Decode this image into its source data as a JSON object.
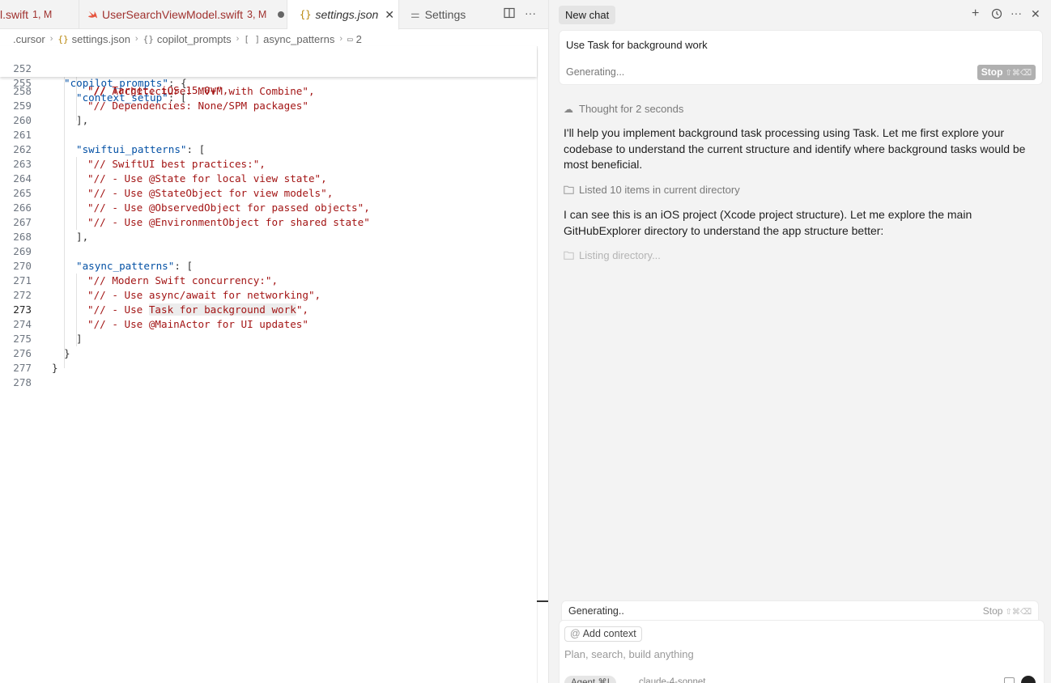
{
  "tabs": [
    {
      "name": "l.swift",
      "badge": "1, M"
    },
    {
      "name": "UserSearchViewModel.swift",
      "badge": "3, M"
    },
    {
      "name": "settings.json",
      "close": "✕"
    },
    {
      "name": "Settings"
    }
  ],
  "breadcrumb": [
    ".cursor",
    "settings.json",
    "copilot_prompts",
    "async_patterns",
    "2"
  ],
  "sticky_lines": [
    {
      "n": "252",
      "key": "copilot_prompts",
      "rest": ": {"
    },
    {
      "n": "255",
      "key": "context_setup",
      "rest": ": ["
    }
  ],
  "partial_line": "\"// Target: iOS 15.0+\",",
  "code_lines": [
    {
      "n": "258",
      "text": "\"// Architecture: MVVM with Combine\","
    },
    {
      "n": "259",
      "text": "\"// Dependencies: None/SPM packages\""
    },
    {
      "n": "260",
      "text": "],"
    },
    {
      "n": "261",
      "text": ""
    },
    {
      "n": "262",
      "key": "swiftui_patterns",
      "rest": ": ["
    },
    {
      "n": "263",
      "text": "\"// SwiftUI best practices:\","
    },
    {
      "n": "264",
      "text": "\"// - Use @State for local view state\","
    },
    {
      "n": "265",
      "text": "\"// - Use @StateObject for view models\","
    },
    {
      "n": "266",
      "text": "\"// - Use @ObservedObject for passed objects\","
    },
    {
      "n": "267",
      "text": "\"// - Use @EnvironmentObject for shared state\""
    },
    {
      "n": "268",
      "text": "],"
    },
    {
      "n": "269",
      "text": ""
    },
    {
      "n": "270",
      "key": "async_patterns",
      "rest": ": ["
    },
    {
      "n": "271",
      "text": "\"// Modern Swift concurrency:\","
    },
    {
      "n": "272",
      "text": "\"// - Use async/await for networking\","
    },
    {
      "n": "273",
      "pre": "\"// - Use ",
      "hl": "Task for background work",
      "post": "\",",
      "active": true
    },
    {
      "n": "274",
      "text": "\"// - Use @MainActor for UI updates\""
    },
    {
      "n": "275",
      "text": "]"
    },
    {
      "n": "276",
      "text": "}"
    },
    {
      "n": "277",
      "text": "}"
    },
    {
      "n": "278",
      "text": ""
    }
  ],
  "chat": {
    "title": "New chat",
    "query": "Use Task for background work",
    "query_status": "Generating...",
    "stop_label": "Stop",
    "stop_kbd": "⇧⌘⌫",
    "thought": "Thought for 2 seconds",
    "message_1": "I'll help you implement background task processing using Task. Let me first explore your codebase to understand the current structure and identify where background tasks would be most beneficial.",
    "listed": "Listed 10 items in current directory",
    "message_2": "I can see this is an iOS project (Xcode project structure). Let me explore the main GitHubExplorer directory to understand the app structure better:",
    "listing": "Listing directory...",
    "generating": "Generating..",
    "gen_stop": "Stop",
    "gen_stop_kbd": "⇧⌘⌫",
    "add_context": "Add context",
    "input_placeholder": "Plan, search, build anything",
    "agent": "Agent ⌘I",
    "model": "claude-4-sonnet"
  },
  "colors": {
    "key": "#0451a5",
    "string": "#a31515",
    "modified_tab": "#a0322f"
  }
}
